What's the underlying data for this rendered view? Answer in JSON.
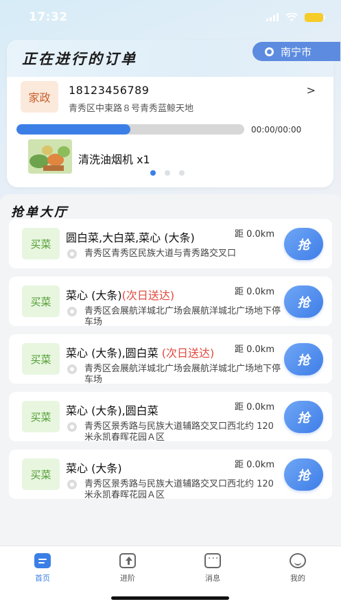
{
  "status_bar": {
    "time": "17:32"
  },
  "order_panel": {
    "title": "正在进行的订单",
    "city": "南宁市",
    "order": {
      "tag": "家政",
      "phone": "18123456789",
      "address": "青秀区中柬路８号青秀蓝鲸天地",
      "progress": 0.5,
      "time": "00:00/00:00",
      "product": "清洗油烟机 x1"
    },
    "pager": {
      "count": 3,
      "active": 0
    }
  },
  "hall": {
    "title": "抢单大厅",
    "grab_label": "抢",
    "cards": [
      {
        "tag": "买菜",
        "title": "圆白菜,大白菜,菜心 (大条)",
        "next_day": "",
        "distance": "距 0.0km",
        "address": "青秀区青秀区民族大道与青秀路交叉口"
      },
      {
        "tag": "买菜",
        "title": "菜心 (大条)",
        "next_day": "(次日送达)",
        "distance": "距 0.0km",
        "address": "青秀区会展航洋城北广场会展航洋城北广场地下停车场"
      },
      {
        "tag": "买菜",
        "title": "菜心 (大条),圆白菜 ",
        "next_day": "(次日送达)",
        "distance": "距 0.0km",
        "address": "青秀区会展航洋城北广场会展航洋城北广场地下停车场"
      },
      {
        "tag": "买菜",
        "title": "菜心 (大条),圆白菜",
        "next_day": "",
        "distance": "距 0.0km",
        "address": "青秀区景秀路与民族大道辅路交叉口西北约 120 米永凯春晖花园Ａ区"
      },
      {
        "tag": "买菜",
        "title": "菜心 (大条)",
        "next_day": "",
        "distance": "距 0.0km",
        "address": "青秀区景秀路与民族大道辅路交叉口西北约 120 米永凯春晖花园Ａ区"
      }
    ]
  },
  "tabbar": {
    "items": [
      {
        "label": "首页",
        "icon": "home-icon",
        "active": true
      },
      {
        "label": "进阶",
        "icon": "upgrade-icon",
        "active": false
      },
      {
        "label": "消息",
        "icon": "message-icon",
        "active": false
      },
      {
        "label": "我的",
        "icon": "profile-icon",
        "active": false
      }
    ]
  },
  "colors": {
    "accent": "#3b7fe6",
    "tag_housekeeping_bg": "#fbe9dc",
    "tag_grocery_bg": "#e8f6e0",
    "next_day": "#e0483e"
  }
}
